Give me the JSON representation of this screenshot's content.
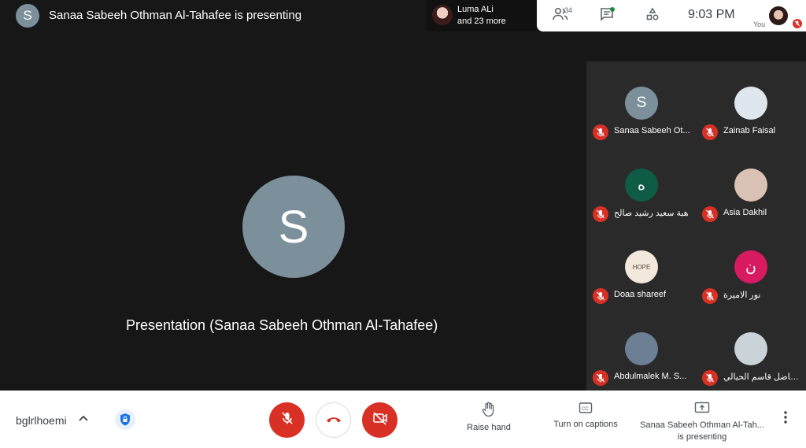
{
  "top": {
    "presenter_initial": "S",
    "presenter_title": "Sanaa Sabeeh Othman Al-Tahafee is presenting",
    "people_chip": {
      "name": "Luma ALi",
      "more": "and 23 more"
    },
    "participant_count": "34",
    "time": "9:03 PM",
    "self_label": "You"
  },
  "stage": {
    "initial": "S",
    "label": "Presentation (Sanaa Sabeeh Othman Al-Tahafee)"
  },
  "participants": [
    {
      "name": "Sanaa Sabeeh Ot...",
      "initial": "S",
      "bg": "#7c909b"
    },
    {
      "name": "Zainab Faisal",
      "initial": "",
      "bg": "#dfe6ee"
    },
    {
      "name": "هبة سعيد رشيد صالح",
      "initial": "ه",
      "bg": "#0e5c46"
    },
    {
      "name": "Asia Dakhil",
      "initial": "",
      "bg": "#d9c2b5"
    },
    {
      "name": "Doaa shareef",
      "initial": "HOPE",
      "bg": "#f2e8dc"
    },
    {
      "name": "نور الاميرة",
      "initial": "ن",
      "bg": "#d81b60"
    },
    {
      "name": "Abdulmalek M. S...",
      "initial": "",
      "bg": "#6d7f95"
    },
    {
      "name": "لماك فاضل قاسم الحيالي",
      "initial": "",
      "bg": "#c9d3d8"
    }
  ],
  "bottom": {
    "meeting_code": "bglrlhoemi",
    "raise_hand": "Raise hand",
    "captions": "Turn on captions",
    "presenting_line1": "Sanaa Sabeeh Othman Al-Tah...",
    "presenting_line2": "is presenting"
  },
  "colors": {
    "danger": "#d93025",
    "stage_bg": "#171717",
    "grid_bg": "#2a2a2a"
  }
}
